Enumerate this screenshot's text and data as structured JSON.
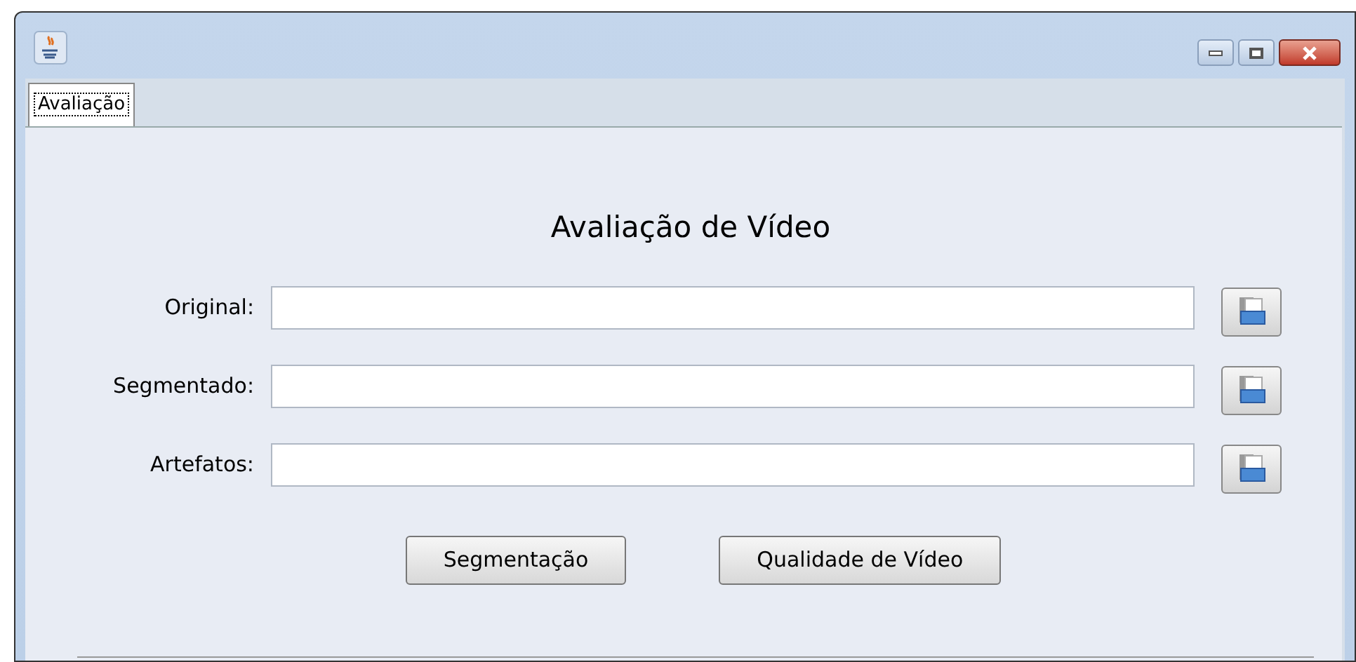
{
  "tabs": [
    {
      "label": "Avaliação",
      "selected": true
    }
  ],
  "heading": "Avaliação de Vídeo",
  "fields": [
    {
      "label": "Original:"
    },
    {
      "label": "Segmentado:"
    },
    {
      "label": "Artefatos:"
    }
  ],
  "buttons": [
    "Segmentação",
    "Qualidade de Vídeo"
  ]
}
